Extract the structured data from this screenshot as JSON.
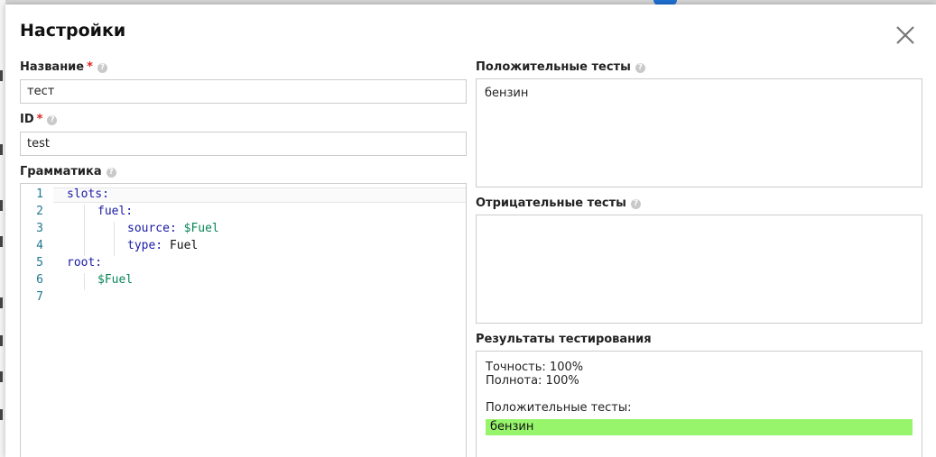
{
  "dialog": {
    "title": "Настройки",
    "close_icon": "close-icon"
  },
  "name_field": {
    "label": "Название",
    "required": "*",
    "value": "тест",
    "help_icon": "?"
  },
  "id_field": {
    "label": "ID",
    "required": "*",
    "value": "test",
    "help_icon": "?"
  },
  "grammar": {
    "label": "Грамматика",
    "help_icon": "?",
    "lines": [
      {
        "num": "1",
        "text": "slots:"
      },
      {
        "num": "2",
        "text": "fuel:"
      },
      {
        "num": "3",
        "key": "source:",
        "value": "$Fuel"
      },
      {
        "num": "4",
        "key": "type:",
        "value": "Fuel"
      },
      {
        "num": "5",
        "text": "root:"
      },
      {
        "num": "6",
        "value": "$Fuel"
      },
      {
        "num": "7",
        "text": ""
      }
    ]
  },
  "positive_tests": {
    "label": "Положительные тесты",
    "help_icon": "?",
    "value": "бензин"
  },
  "negative_tests": {
    "label": "Отрицательные тесты",
    "help_icon": "?",
    "value": ""
  },
  "results": {
    "label": "Результаты тестирования",
    "accuracy": "Точность: 100%",
    "recall": "Полнота: 100%",
    "positive_header": "Положительные тесты:",
    "passed_items": [
      "бензин"
    ],
    "pass_color": "#97f56c"
  }
}
